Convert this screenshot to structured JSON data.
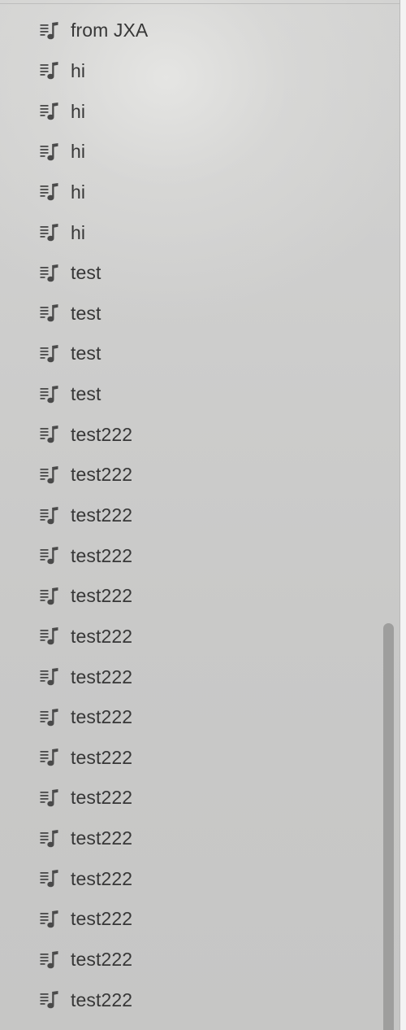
{
  "playlists": [
    {
      "label": "from JXA",
      "icon": "playlist-icon"
    },
    {
      "label": "hi",
      "icon": "playlist-icon"
    },
    {
      "label": "hi",
      "icon": "playlist-icon"
    },
    {
      "label": "hi",
      "icon": "playlist-icon"
    },
    {
      "label": "hi",
      "icon": "playlist-icon"
    },
    {
      "label": "hi",
      "icon": "playlist-icon"
    },
    {
      "label": "test",
      "icon": "playlist-icon"
    },
    {
      "label": "test",
      "icon": "playlist-icon"
    },
    {
      "label": "test",
      "icon": "playlist-icon"
    },
    {
      "label": "test",
      "icon": "playlist-icon"
    },
    {
      "label": "test222",
      "icon": "playlist-icon"
    },
    {
      "label": "test222",
      "icon": "playlist-icon"
    },
    {
      "label": "test222",
      "icon": "playlist-icon"
    },
    {
      "label": "test222",
      "icon": "playlist-icon"
    },
    {
      "label": "test222",
      "icon": "playlist-icon"
    },
    {
      "label": "test222",
      "icon": "playlist-icon"
    },
    {
      "label": "test222",
      "icon": "playlist-icon"
    },
    {
      "label": "test222",
      "icon": "playlist-icon"
    },
    {
      "label": "test222",
      "icon": "playlist-icon"
    },
    {
      "label": "test222",
      "icon": "playlist-icon"
    },
    {
      "label": "test222",
      "icon": "playlist-icon"
    },
    {
      "label": "test222",
      "icon": "playlist-icon"
    },
    {
      "label": "test222",
      "icon": "playlist-icon"
    },
    {
      "label": "test222",
      "icon": "playlist-icon"
    },
    {
      "label": "test222",
      "icon": "playlist-icon"
    }
  ],
  "colors": {
    "sidebar_bg": "#cbcbca",
    "text": "#373737",
    "icon": "#4a4a4a",
    "scroll_thumb": "#9e9e9d"
  }
}
